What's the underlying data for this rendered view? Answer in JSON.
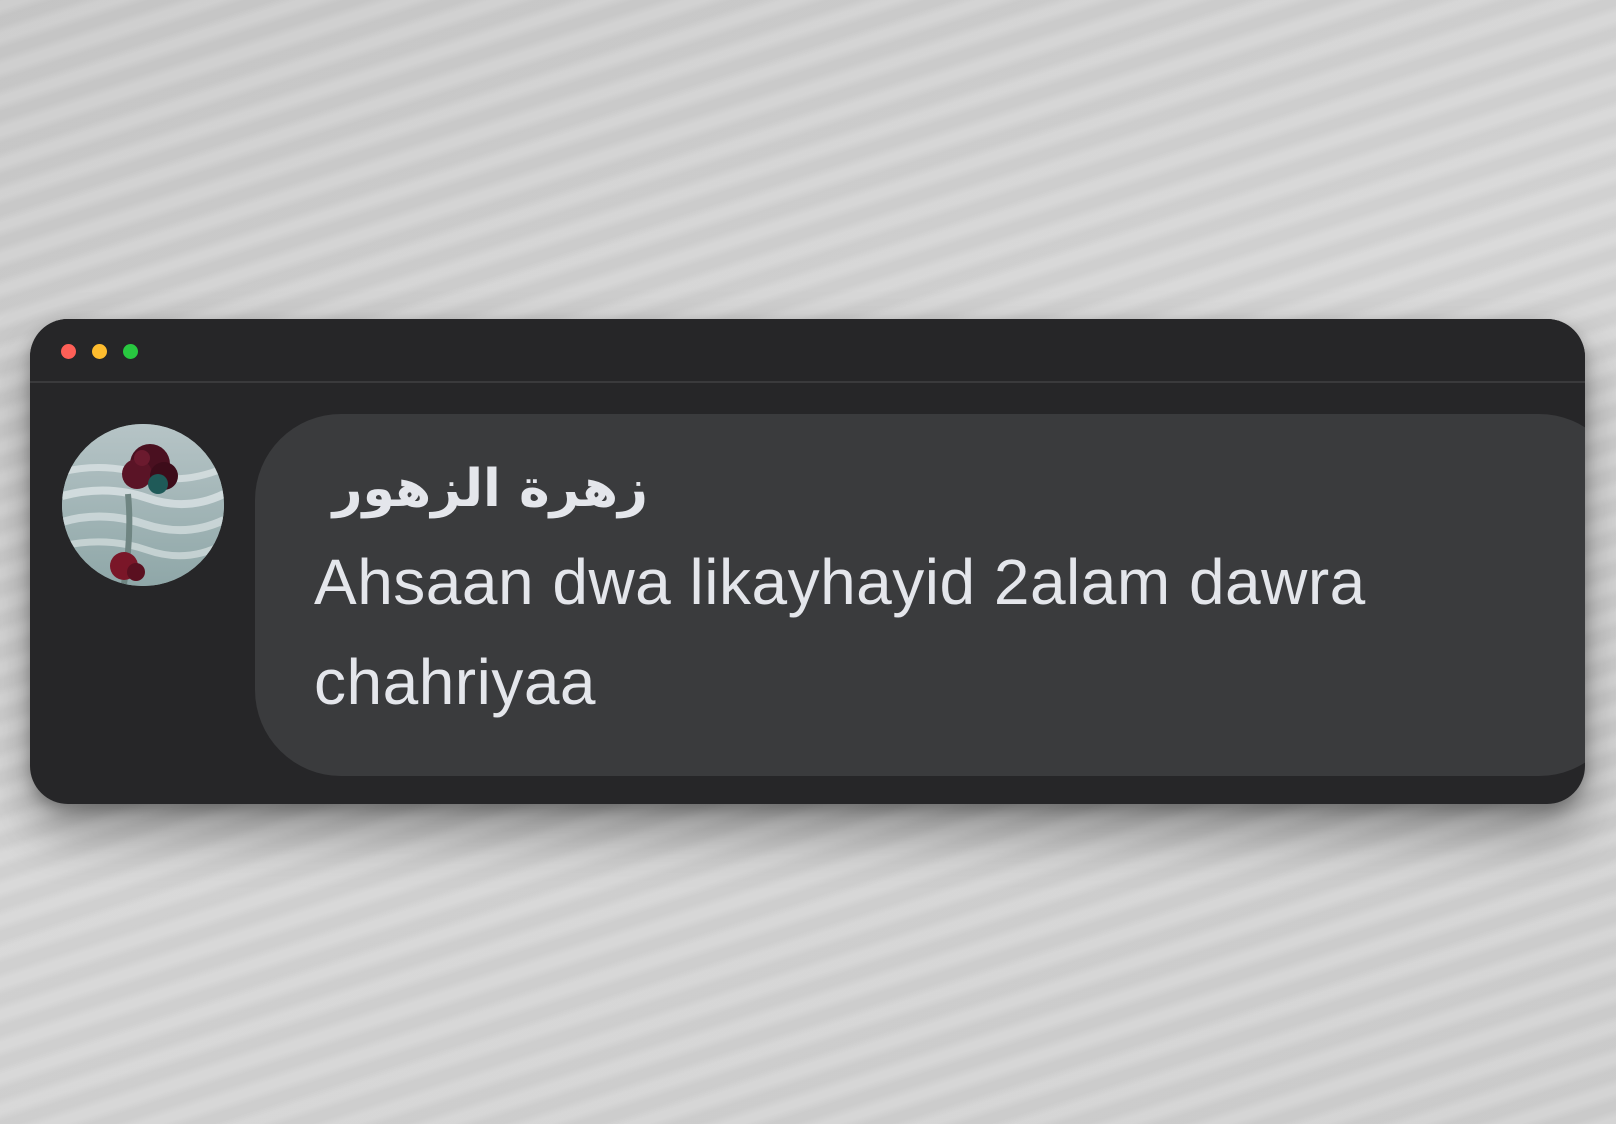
{
  "window": {
    "controls": {
      "close_color": "#fe5f57",
      "minimize_color": "#febc2e",
      "maximize_color": "#28c840"
    }
  },
  "comment": {
    "author": "زهرة الزهور",
    "text": "Ahsaan dwa likayhayid 2alam dawra chahriyaa",
    "avatar_icon": "flower-avatar-icon",
    "bubble_color": "#3a3b3d",
    "text_color": "#e4e6eb"
  }
}
